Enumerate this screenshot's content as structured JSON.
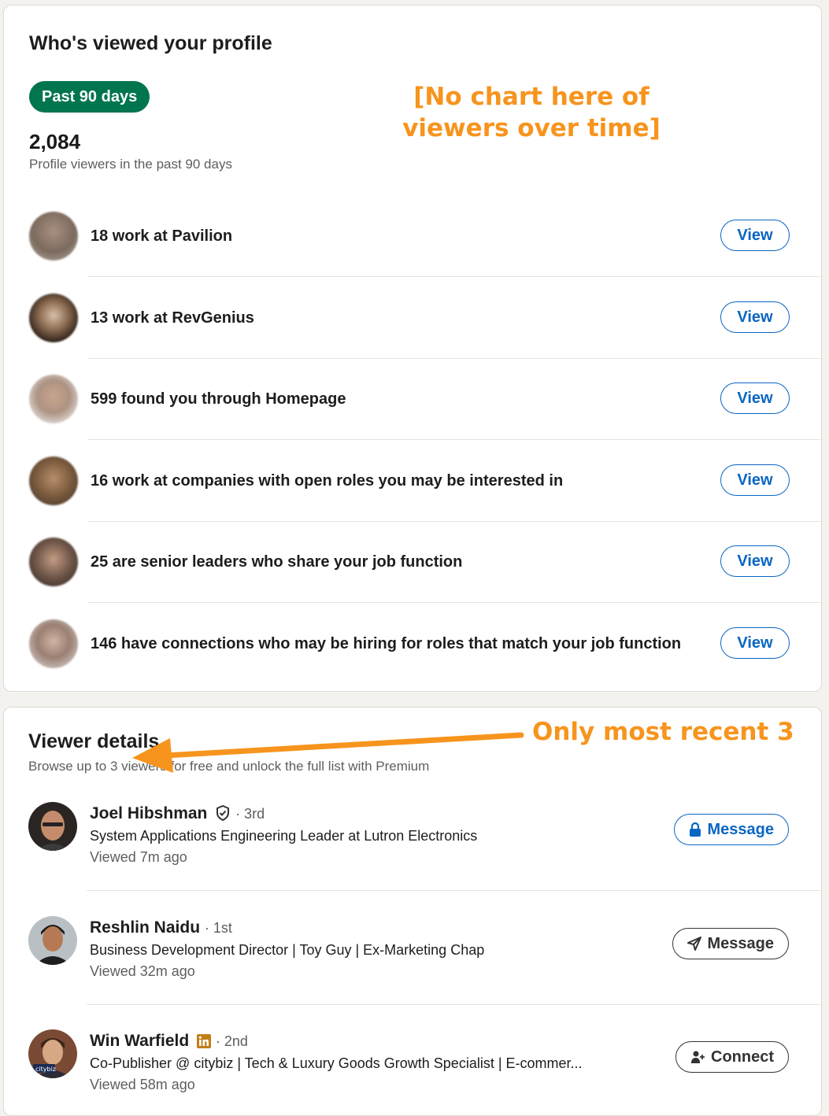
{
  "overview": {
    "title": "Who's viewed your profile",
    "range_pill": "Past 90 days",
    "count": "2,084",
    "count_label": "Profile viewers in the past 90 days",
    "annotation": "[No chart here of viewers over time]"
  },
  "insights": [
    {
      "text": "18 work at  Pavilion",
      "view_label": "View"
    },
    {
      "text": "13 work at  RevGenius",
      "view_label": "View"
    },
    {
      "text": "599 found you through Homepage",
      "view_label": "View"
    },
    {
      "text": "16 work at companies with open roles you may be interested in",
      "view_label": "View"
    },
    {
      "text": "25 are senior leaders who share your job function",
      "view_label": "View"
    },
    {
      "text": "146 have connections who may be hiring for roles that match your job function",
      "view_label": "View"
    }
  ],
  "viewer_details": {
    "title": "Viewer details",
    "subtitle": "Browse up to 3 viewers for free and unlock the full list with Premium",
    "annotation": "Only most recent 3",
    "viewers": [
      {
        "name": "Joel Hibshman",
        "degree": "· 3rd",
        "headline": "System Applications Engineering Leader at Lutron Electronics",
        "viewed": "Viewed 7m ago",
        "action": "Message",
        "badge_icon": "verified-shield-icon",
        "action_icon": "lock-icon"
      },
      {
        "name": "Reshlin Naidu",
        "degree": "· 1st",
        "headline": "Business Development Director | Toy Guy | Ex-Marketing Chap",
        "viewed": "Viewed 32m ago",
        "action": "Message",
        "action_icon": "send-icon"
      },
      {
        "name": "Win Warfield",
        "degree": "· 2nd",
        "headline": "Co-Publisher @ citybiz | Tech & Luxury Goods Growth Specialist | E-commer...",
        "viewed": "Viewed 58m ago",
        "action": "Connect",
        "badge_icon": "linkedin-icon",
        "action_icon": "add-person-icon"
      }
    ]
  },
  "colors": {
    "accent_green": "#01754f",
    "link_blue": "#0a66c2",
    "annotation_orange": "#f7941d"
  }
}
